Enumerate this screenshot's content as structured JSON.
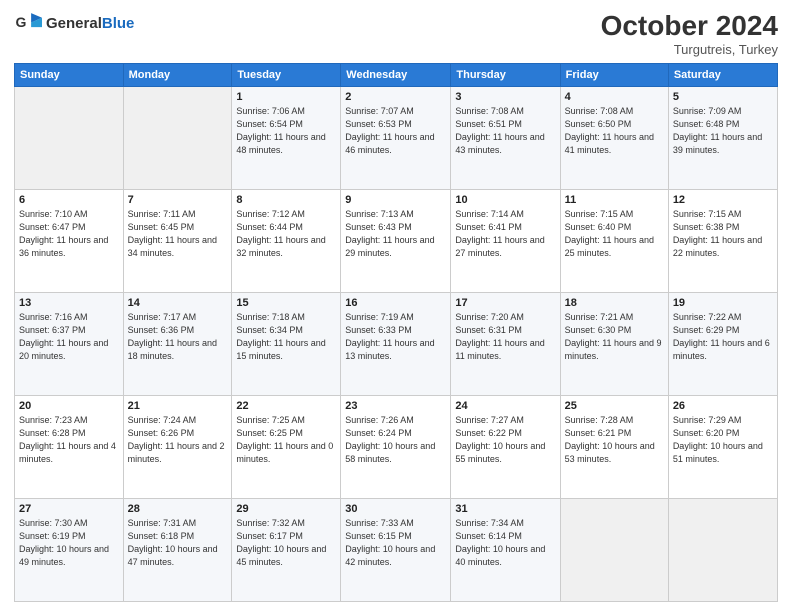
{
  "header": {
    "logo_general": "General",
    "logo_blue": "Blue",
    "month_year": "October 2024",
    "location": "Turgutreis, Turkey"
  },
  "weekdays": [
    "Sunday",
    "Monday",
    "Tuesday",
    "Wednesday",
    "Thursday",
    "Friday",
    "Saturday"
  ],
  "weeks": [
    [
      {
        "day": "",
        "sunrise": "",
        "sunset": "",
        "daylight": "",
        "empty": true
      },
      {
        "day": "",
        "sunrise": "",
        "sunset": "",
        "daylight": "",
        "empty": true
      },
      {
        "day": "1",
        "sunrise": "Sunrise: 7:06 AM",
        "sunset": "Sunset: 6:54 PM",
        "daylight": "Daylight: 11 hours and 48 minutes."
      },
      {
        "day": "2",
        "sunrise": "Sunrise: 7:07 AM",
        "sunset": "Sunset: 6:53 PM",
        "daylight": "Daylight: 11 hours and 46 minutes."
      },
      {
        "day": "3",
        "sunrise": "Sunrise: 7:08 AM",
        "sunset": "Sunset: 6:51 PM",
        "daylight": "Daylight: 11 hours and 43 minutes."
      },
      {
        "day": "4",
        "sunrise": "Sunrise: 7:08 AM",
        "sunset": "Sunset: 6:50 PM",
        "daylight": "Daylight: 11 hours and 41 minutes."
      },
      {
        "day": "5",
        "sunrise": "Sunrise: 7:09 AM",
        "sunset": "Sunset: 6:48 PM",
        "daylight": "Daylight: 11 hours and 39 minutes."
      }
    ],
    [
      {
        "day": "6",
        "sunrise": "Sunrise: 7:10 AM",
        "sunset": "Sunset: 6:47 PM",
        "daylight": "Daylight: 11 hours and 36 minutes."
      },
      {
        "day": "7",
        "sunrise": "Sunrise: 7:11 AM",
        "sunset": "Sunset: 6:45 PM",
        "daylight": "Daylight: 11 hours and 34 minutes."
      },
      {
        "day": "8",
        "sunrise": "Sunrise: 7:12 AM",
        "sunset": "Sunset: 6:44 PM",
        "daylight": "Daylight: 11 hours and 32 minutes."
      },
      {
        "day": "9",
        "sunrise": "Sunrise: 7:13 AM",
        "sunset": "Sunset: 6:43 PM",
        "daylight": "Daylight: 11 hours and 29 minutes."
      },
      {
        "day": "10",
        "sunrise": "Sunrise: 7:14 AM",
        "sunset": "Sunset: 6:41 PM",
        "daylight": "Daylight: 11 hours and 27 minutes."
      },
      {
        "day": "11",
        "sunrise": "Sunrise: 7:15 AM",
        "sunset": "Sunset: 6:40 PM",
        "daylight": "Daylight: 11 hours and 25 minutes."
      },
      {
        "day": "12",
        "sunrise": "Sunrise: 7:15 AM",
        "sunset": "Sunset: 6:38 PM",
        "daylight": "Daylight: 11 hours and 22 minutes."
      }
    ],
    [
      {
        "day": "13",
        "sunrise": "Sunrise: 7:16 AM",
        "sunset": "Sunset: 6:37 PM",
        "daylight": "Daylight: 11 hours and 20 minutes."
      },
      {
        "day": "14",
        "sunrise": "Sunrise: 7:17 AM",
        "sunset": "Sunset: 6:36 PM",
        "daylight": "Daylight: 11 hours and 18 minutes."
      },
      {
        "day": "15",
        "sunrise": "Sunrise: 7:18 AM",
        "sunset": "Sunset: 6:34 PM",
        "daylight": "Daylight: 11 hours and 15 minutes."
      },
      {
        "day": "16",
        "sunrise": "Sunrise: 7:19 AM",
        "sunset": "Sunset: 6:33 PM",
        "daylight": "Daylight: 11 hours and 13 minutes."
      },
      {
        "day": "17",
        "sunrise": "Sunrise: 7:20 AM",
        "sunset": "Sunset: 6:31 PM",
        "daylight": "Daylight: 11 hours and 11 minutes."
      },
      {
        "day": "18",
        "sunrise": "Sunrise: 7:21 AM",
        "sunset": "Sunset: 6:30 PM",
        "daylight": "Daylight: 11 hours and 9 minutes."
      },
      {
        "day": "19",
        "sunrise": "Sunrise: 7:22 AM",
        "sunset": "Sunset: 6:29 PM",
        "daylight": "Daylight: 11 hours and 6 minutes."
      }
    ],
    [
      {
        "day": "20",
        "sunrise": "Sunrise: 7:23 AM",
        "sunset": "Sunset: 6:28 PM",
        "daylight": "Daylight: 11 hours and 4 minutes."
      },
      {
        "day": "21",
        "sunrise": "Sunrise: 7:24 AM",
        "sunset": "Sunset: 6:26 PM",
        "daylight": "Daylight: 11 hours and 2 minutes."
      },
      {
        "day": "22",
        "sunrise": "Sunrise: 7:25 AM",
        "sunset": "Sunset: 6:25 PM",
        "daylight": "Daylight: 11 hours and 0 minutes."
      },
      {
        "day": "23",
        "sunrise": "Sunrise: 7:26 AM",
        "sunset": "Sunset: 6:24 PM",
        "daylight": "Daylight: 10 hours and 58 minutes."
      },
      {
        "day": "24",
        "sunrise": "Sunrise: 7:27 AM",
        "sunset": "Sunset: 6:22 PM",
        "daylight": "Daylight: 10 hours and 55 minutes."
      },
      {
        "day": "25",
        "sunrise": "Sunrise: 7:28 AM",
        "sunset": "Sunset: 6:21 PM",
        "daylight": "Daylight: 10 hours and 53 minutes."
      },
      {
        "day": "26",
        "sunrise": "Sunrise: 7:29 AM",
        "sunset": "Sunset: 6:20 PM",
        "daylight": "Daylight: 10 hours and 51 minutes."
      }
    ],
    [
      {
        "day": "27",
        "sunrise": "Sunrise: 7:30 AM",
        "sunset": "Sunset: 6:19 PM",
        "daylight": "Daylight: 10 hours and 49 minutes."
      },
      {
        "day": "28",
        "sunrise": "Sunrise: 7:31 AM",
        "sunset": "Sunset: 6:18 PM",
        "daylight": "Daylight: 10 hours and 47 minutes."
      },
      {
        "day": "29",
        "sunrise": "Sunrise: 7:32 AM",
        "sunset": "Sunset: 6:17 PM",
        "daylight": "Daylight: 10 hours and 45 minutes."
      },
      {
        "day": "30",
        "sunrise": "Sunrise: 7:33 AM",
        "sunset": "Sunset: 6:15 PM",
        "daylight": "Daylight: 10 hours and 42 minutes."
      },
      {
        "day": "31",
        "sunrise": "Sunrise: 7:34 AM",
        "sunset": "Sunset: 6:14 PM",
        "daylight": "Daylight: 10 hours and 40 minutes."
      },
      {
        "day": "",
        "sunrise": "",
        "sunset": "",
        "daylight": "",
        "empty": true
      },
      {
        "day": "",
        "sunrise": "",
        "sunset": "",
        "daylight": "",
        "empty": true
      }
    ]
  ]
}
